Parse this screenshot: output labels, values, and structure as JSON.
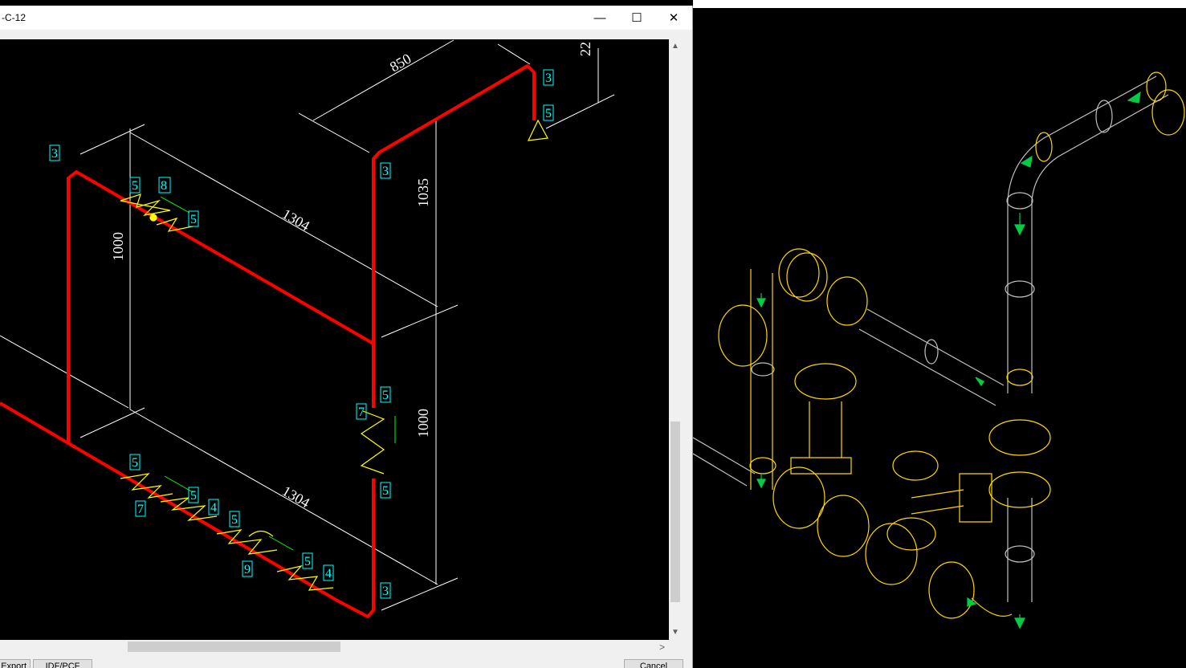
{
  "window": {
    "title": "-C-12",
    "minimize_glyph": "—",
    "maximize_glyph": "☐",
    "close_glyph": "✕"
  },
  "drawing": {
    "dimensions": [
      "850",
      "22",
      "1035",
      "1000",
      "1304",
      "1000",
      "1304"
    ],
    "component_tags": [
      "3",
      "5",
      "3",
      "3",
      "5",
      "8",
      "5",
      "5",
      "7",
      "5",
      "5",
      "7",
      "5",
      "4",
      "5",
      "9",
      "5",
      "4",
      "3"
    ],
    "pipe_color": "#ff0000",
    "dimension_color": "#ffffff",
    "tag_color": "#00ffff",
    "fitting_color": "#ffff00",
    "flow_arrow_color": "#00ff00"
  },
  "scrollbars": {
    "up_glyph": "▲",
    "down_glyph": "▼",
    "right_glyph": ">"
  },
  "buttons": {
    "export_label": "Export",
    "idf_pcf_label": "IDF/PCF",
    "cancel_label": "Cancel"
  },
  "viewer3d": {
    "wireframe_colors": {
      "pipe": "#c0c0c0",
      "fitting": "#ffd700",
      "arrow": "#00cc44"
    }
  }
}
